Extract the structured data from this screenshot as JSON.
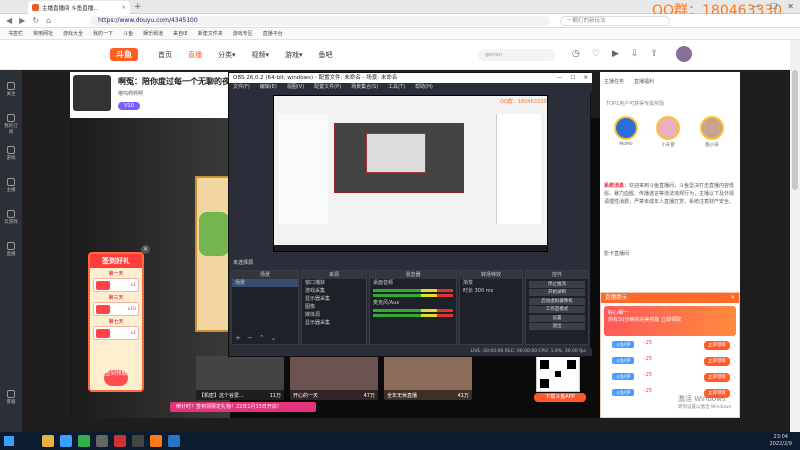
{
  "browser": {
    "tab_title": "主播直播间 斗鱼直播...",
    "watermark": "QQ群：180463330",
    "url": "https://www.douyu.com/4345100",
    "search_placeholder": "一颗灯的新玩法",
    "nav": [
      "◀",
      "▶",
      "↻",
      "⌂"
    ],
    "bookmarks": [
      "书签栏",
      "常用网址",
      "游戏大全",
      "我的一下",
      "斗鱼",
      "娱乐频道",
      "来自IE",
      "新建文件夹",
      "游戏专区",
      "直播平台"
    ]
  },
  "douyu": {
    "logo": "斗鱼",
    "menu": [
      "首页",
      "直播",
      "分类▾",
      "视频▾",
      "游戏▾",
      "鱼吧"
    ],
    "search_placeholder": "genian",
    "streamer": {
      "title": "啊冤：陪你度过每一个无聊的夜",
      "name": "嗷呜啊啊啊",
      "badge": "V10"
    },
    "rail": [
      "关注",
      "我的订阅",
      "游戏",
      "主播",
      "云游戏",
      "直播",
      "客服"
    ],
    "signin": {
      "header": "签到好礼",
      "days": [
        "第一天",
        "第三天",
        "第七天"
      ],
      "amounts": [
        "x1",
        "x10",
        "x1"
      ],
      "button": "签到领取"
    },
    "thumbs": [
      {
        "cap": "【机密】这个谷爱...",
        "hot": "11万"
      },
      {
        "cap": "开心的一天",
        "hot": "47万"
      },
      {
        "cap": "全年无休直播",
        "hot": "41万"
      }
    ],
    "promo": "倒计时！签到领限定礼物！22年1月15日开启！",
    "rank_label": "TOP1用户可获得专属奖励",
    "right_top": [
      "主播任务",
      "直播福利"
    ],
    "rank_names": [
      "MoMo",
      "小天使",
      "酷小孩"
    ],
    "notice_head": "系统消息：",
    "notice": "欢迎来到斗鱼直播间，斗鱼坚决打击直播内容低俗、暴力血腥、传播谣言等违法违规行为，主播以下及外观请理性消费，严禁未成年人直播打赏，系统注意财产安全。",
    "chat": "影卡直播间",
    "gift": {
      "header": "直播提示",
      "close": "✕",
      "banner_line1": "好心相一",
      "banner_line2": "你有30分钟的完美奖励 立即领取",
      "items": [
        "-25",
        "-25",
        "-25",
        "-25"
      ],
      "item_tag": "斗鱼VIP",
      "item_btn": "立即领取"
    },
    "app_btn": "下载斗鱼APP",
    "windows_activate": "激活 Windows",
    "windows_hint": "转到设置以激活 Windows"
  },
  "obs": {
    "title": "OBS 26.0.2 (64-bit, windows) - 配置文件: 未命名 - 场景: 未命名",
    "menu": [
      "文件(F)",
      "编辑(E)",
      "视图(V)",
      "配置文件(P)",
      "场景集合(S)",
      "工具(T)",
      "帮助(H)"
    ],
    "preview_watermark": "QQ群：180463330",
    "no_source": "未选择源",
    "scenes_header": "场景",
    "scenes": [
      "场景"
    ],
    "sources_header": "来源",
    "sources": [
      "窗口捕获",
      "游戏采集",
      "显示器采集",
      "图像",
      "媒体源",
      "显示器采集"
    ],
    "mixer_header": "混音器",
    "mixer": [
      "桌面音频",
      "麦克风/Aux"
    ],
    "transition_header": "转场特效",
    "transition": [
      "渐变",
      "时长 300 ms"
    ],
    "controls_header": "控件",
    "controls": [
      "停止推流",
      "开始录制",
      "启动虚拟摄像机",
      "工作室模式",
      "设置",
      "退出"
    ],
    "status": "LIVE: 00:00:00  REC: 00:00:00  CPU: 1.9%, 30.00 fps"
  },
  "taskbar": {
    "time": "23:04",
    "date": "2022/2/9"
  }
}
